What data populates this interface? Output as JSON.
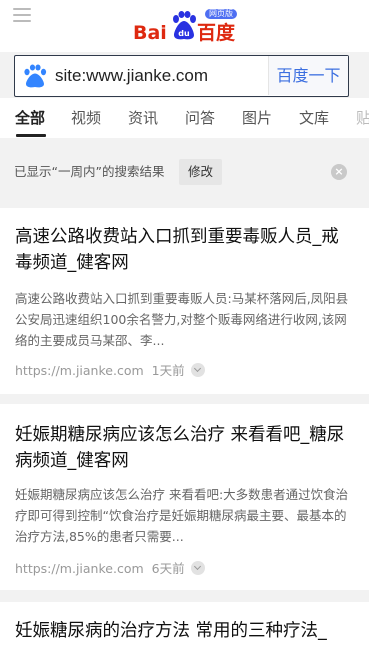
{
  "header": {
    "logo_bai": "Bai",
    "logo_du": "百度",
    "logo_paw_text": "du",
    "logo_badge": "网页版"
  },
  "search": {
    "value": "site:www.jianke.com",
    "button_label": "百度一下"
  },
  "tabs": [
    "全部",
    "视频",
    "资讯",
    "问答",
    "图片",
    "文库",
    "贴"
  ],
  "filter": {
    "text": "已显示“一周内”的搜索结果",
    "button_label": "修改",
    "close_icon": "×"
  },
  "results": [
    {
      "title": "高速公路收费站入口抓到重要毒贩人员_戒毒频道_健客网",
      "abstract": "高速公路收费站入口抓到重要毒贩人员:马某杯落网后,凤阳县公安局迅速组织100余名警力,对整个贩毒网络进行收网,该网络的主要成员马某邵、李...",
      "url": "https://m.jianke.com",
      "time": "1天前"
    },
    {
      "title": "妊娠期糖尿病应该怎么治疗 来看看吧_糖尿病频道_健客网",
      "abstract": "妊娠期糖尿病应该怎么治疗 来看看吧:大多数患者通过饮食治疗即可得到控制“饮食治疗是妊娠期糖尿病最主要、最基本的治疗方法,85%的患者只需要...",
      "url": "https://m.jianke.com",
      "time": "6天前"
    },
    {
      "title": "妊娠糖尿病的治疗方法 常用的三种疗法_"
    }
  ]
}
